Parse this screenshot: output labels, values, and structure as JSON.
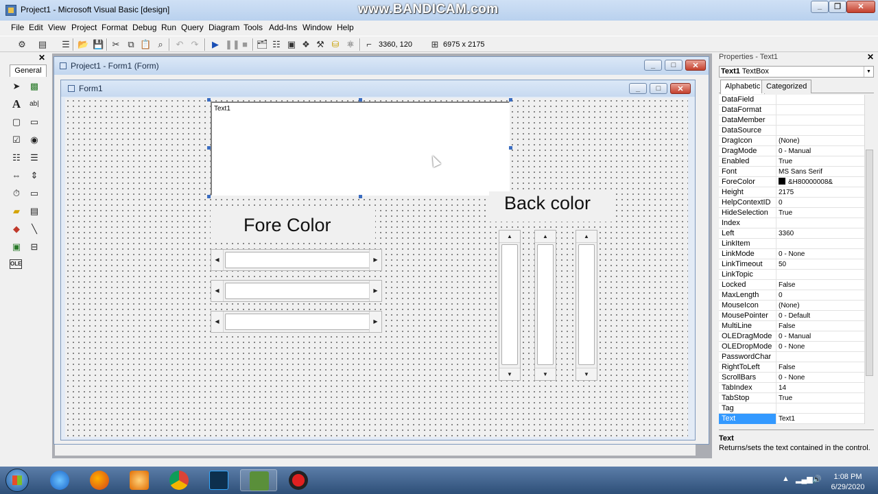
{
  "window": {
    "title": "Project1 - Microsoft Visual Basic [design]",
    "watermark": "www.BANDICAM.com"
  },
  "menu": [
    "File",
    "Edit",
    "View",
    "Project",
    "Format",
    "Debug",
    "Run",
    "Query",
    "Diagram",
    "Tools",
    "Add-Ins",
    "Window",
    "Help"
  ],
  "toolbar": {
    "position_readout": "3360, 120",
    "size_readout": "6975 x 2175"
  },
  "toolbox": {
    "tab_label": "General",
    "tools": [
      "pointer-icon",
      "picturebox-icon",
      "label-icon",
      "textbox-icon",
      "frame-icon",
      "commandbutton-icon",
      "checkbox-icon",
      "optionbutton-icon",
      "combobox-icon",
      "listbox-icon",
      "hscrollbar-icon",
      "vscrollbar-icon",
      "timer-icon",
      "drivelistbox-icon",
      "dirlistbox-icon",
      "filelistbox-icon",
      "shape-icon",
      "line-icon",
      "image-icon",
      "data-icon",
      "ole-icon"
    ]
  },
  "project_window": {
    "title": "Project1 - Form1 (Form)"
  },
  "form": {
    "title": "Form1",
    "textbox_text": "Text1",
    "fore_color_label": "Fore Color",
    "back_color_label": "Back color"
  },
  "properties": {
    "title": "Properties - Text1",
    "object_name": "Text1",
    "object_type": "TextBox",
    "tabs": [
      "Alphabetic",
      "Categorized"
    ],
    "rows": [
      {
        "name": "DataField",
        "value": ""
      },
      {
        "name": "DataFormat",
        "value": ""
      },
      {
        "name": "DataMember",
        "value": ""
      },
      {
        "name": "DataSource",
        "value": ""
      },
      {
        "name": "DragIcon",
        "value": "(None)"
      },
      {
        "name": "DragMode",
        "value": "0 - Manual"
      },
      {
        "name": "Enabled",
        "value": "True"
      },
      {
        "name": "Font",
        "value": "MS Sans Serif"
      },
      {
        "name": "ForeColor",
        "value": "&H80000008&"
      },
      {
        "name": "Height",
        "value": "2175"
      },
      {
        "name": "HelpContextID",
        "value": "0"
      },
      {
        "name": "HideSelection",
        "value": "True"
      },
      {
        "name": "Index",
        "value": ""
      },
      {
        "name": "Left",
        "value": "3360"
      },
      {
        "name": "LinkItem",
        "value": ""
      },
      {
        "name": "LinkMode",
        "value": "0 - None"
      },
      {
        "name": "LinkTimeout",
        "value": "50"
      },
      {
        "name": "LinkTopic",
        "value": ""
      },
      {
        "name": "Locked",
        "value": "False"
      },
      {
        "name": "MaxLength",
        "value": "0"
      },
      {
        "name": "MouseIcon",
        "value": "(None)"
      },
      {
        "name": "MousePointer",
        "value": "0 - Default"
      },
      {
        "name": "MultiLine",
        "value": "False"
      },
      {
        "name": "OLEDragMode",
        "value": "0 - Manual"
      },
      {
        "name": "OLEDropMode",
        "value": "0 - None"
      },
      {
        "name": "PasswordChar",
        "value": ""
      },
      {
        "name": "RightToLeft",
        "value": "False"
      },
      {
        "name": "ScrollBars",
        "value": "0 - None"
      },
      {
        "name": "TabIndex",
        "value": "14"
      },
      {
        "name": "TabStop",
        "value": "True"
      },
      {
        "name": "Tag",
        "value": ""
      },
      {
        "name": "Text",
        "value": "Text1"
      }
    ],
    "selected_row": "Text",
    "description_title": "Text",
    "description": "Returns/sets the text contained in the control."
  },
  "taskbar": {
    "apps": [
      "internet-explorer-icon",
      "firefox-icon",
      "media-player-icon",
      "chrome-icon",
      "photoshop-icon",
      "visual-basic-icon",
      "bandicam-icon"
    ],
    "time": "1:08 PM",
    "date": "6/29/2020"
  },
  "colors": {
    "accent": "#3399ff",
    "titlebar": "#c2d6ef",
    "taskbar": "#2e4f78"
  }
}
